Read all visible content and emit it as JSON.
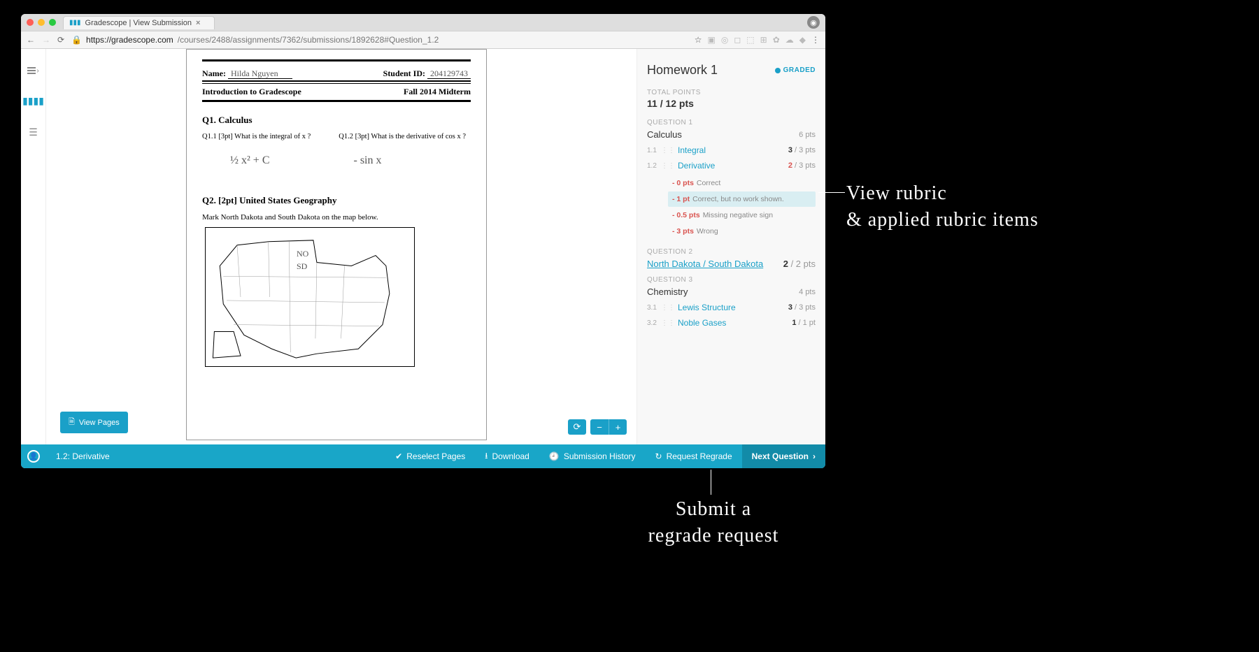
{
  "browser": {
    "tab_title": "Gradescope | View Submission",
    "url_domain": "https://gradescope.com",
    "url_path": "/courses/2488/assignments/7362/submissions/1892628#Question_1.2"
  },
  "document": {
    "name_label": "Name:",
    "student_name": "Hilda Nguyen",
    "id_label": "Student ID:",
    "student_id": "204129743",
    "course_title": "Introduction to Gradescope",
    "term": "Fall 2014 Midterm",
    "q1_title": "Q1.  Calculus",
    "q1_1": "Q1.1   [3pt] What is the integral of x ?",
    "q1_2": "Q1.2   [3pt]  What is the derivative of  cos x ?",
    "ans1": "½ x² + C",
    "ans2": "- sin x",
    "q2_title": "Q2.  [2pt] United States Geography",
    "q2_desc": "Mark North Dakota and South Dakota on the map below.",
    "map_label_no": "NO",
    "map_label_sd": "SD"
  },
  "viewer": {
    "view_pages": "View Pages",
    "rotate": "⟳",
    "minus": "−",
    "plus": "+"
  },
  "sidebar": {
    "title": "Homework 1",
    "badge": "GRADED",
    "total_label": "TOTAL POINTS",
    "total": "11 / 12 pts",
    "q1_label": "QUESTION 1",
    "q1_name": "Calculus",
    "q1_pts": "6 pts",
    "s11_num": "1.1",
    "s11_name": "Integral",
    "s11_score_got": "3",
    "s11_score_of": " / 3 pts",
    "s12_num": "1.2",
    "s12_name": "Derivative",
    "s12_score_got": "2",
    "s12_score_of": " / 3 pts",
    "rubric": [
      {
        "pts": "- 0 pts",
        "txt": "Correct",
        "sel": false
      },
      {
        "pts": "- 1 pt",
        "txt": "Correct, but no work shown.",
        "sel": true
      },
      {
        "pts": "- 0.5 pts",
        "txt": "Missing negative sign",
        "sel": false
      },
      {
        "pts": "- 3 pts",
        "txt": "Wrong",
        "sel": false
      }
    ],
    "q2_label": "QUESTION 2",
    "q2_name": "North Dakota / South Dakota",
    "q2_score_got": "2",
    "q2_score_of": " / 2 pts",
    "q3_label": "QUESTION 3",
    "q3_name": "Chemistry",
    "q3_pts": "4 pts",
    "s31_num": "3.1",
    "s31_name": "Lewis Structure",
    "s31_score_got": "3",
    "s31_score_of": " / 3 pts",
    "s32_num": "3.2",
    "s32_name": "Noble Gases",
    "s32_score_got": "1",
    "s32_score_of": " / 1 pt"
  },
  "footer": {
    "crumb": "1.2: Derivative",
    "reselect": "Reselect Pages",
    "download": "Download",
    "history": "Submission History",
    "regrade": "Request Regrade",
    "next": "Next Question"
  },
  "callouts": {
    "rubric": "View rubric\n& applied rubric items",
    "regrade": "Submit a\nregrade request"
  }
}
